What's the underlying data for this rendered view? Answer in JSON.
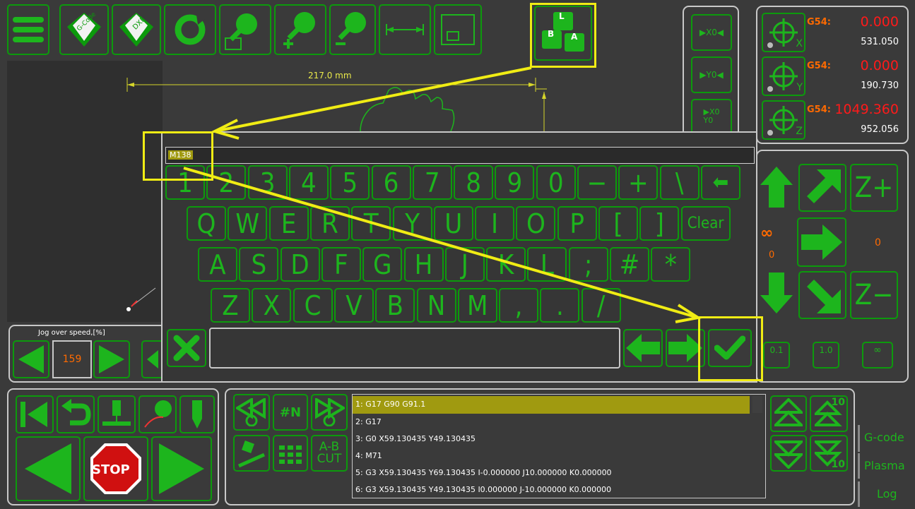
{
  "toolbar": {
    "icons": [
      "menu-icon",
      "gcode-file-icon",
      "dxf-file-icon",
      "refresh-icon",
      "zoom-fit-icon",
      "zoom-in-icon",
      "zoom-out-icon",
      "measure-icon",
      "window-icon",
      "keyboard-layout-icon"
    ],
    "gcode_label": "G-Code",
    "dxf_label": "DXF"
  },
  "keyboard_button": {
    "letters": [
      "L",
      "B",
      "A"
    ]
  },
  "drawing": {
    "dimension": "217.0 mm"
  },
  "zero_buttons": {
    "x0": "▶X0◀",
    "y0": "▶Y0◀",
    "xy0": "▶X0\nY0"
  },
  "dro": [
    {
      "cs": "G54:",
      "work": "0.000",
      "machine": "531.050",
      "axis": "X"
    },
    {
      "cs": "G54:",
      "work": "0.000",
      "machine": "190.730",
      "axis": "Y"
    },
    {
      "cs": "G54:",
      "work": "1049.360",
      "machine": "952.056",
      "axis": "Z"
    }
  ],
  "keyboard": {
    "input": "M138",
    "rows": [
      [
        "1",
        "2",
        "3",
        "4",
        "5",
        "6",
        "7",
        "8",
        "9",
        "0",
        "−",
        "+",
        "\\",
        "⬅"
      ],
      [
        "Q",
        "W",
        "E",
        "R",
        "T",
        "Y",
        "U",
        "I",
        "O",
        "P",
        "[",
        "]",
        "Clear"
      ],
      [
        "A",
        "S",
        "D",
        "F",
        "G",
        "H",
        "J",
        "K",
        "L",
        ";",
        "#",
        "*"
      ],
      [
        "Z",
        "X",
        "C",
        "V",
        "B",
        "N",
        "M",
        ",",
        ".",
        "/"
      ]
    ]
  },
  "jog": {
    "infinity": "∞",
    "left_value": "0",
    "right_value": "0",
    "zplus": "Z+",
    "zminus": "Z−",
    "steps": [
      "0.1",
      "1.0",
      "∞"
    ]
  },
  "jog_speed": {
    "title": "Jog over speed,[%]",
    "value": "159"
  },
  "controls": {
    "stop": "STOP",
    "ab_cut": "A-B\nCUT",
    "hash_n": "#N"
  },
  "gcode": {
    "lines": [
      "1: G17 G90 G91.1",
      "2: G17",
      "3: G0 X59.130435 Y49.130435",
      "4: M71",
      "5: G3 X59.130435 Y69.130435 I-0.000000 J10.000000 K0.000000",
      "6: G3 X59.130435 Y49.130435 I0.000000 J-10.000000 K0.000000"
    ]
  },
  "scroll": {
    "ten_up": "10",
    "ten_down": "10"
  },
  "tabs": [
    "G-code",
    "Plasma",
    "Log"
  ],
  "colors": {
    "accent": "#1db51d",
    "highlight": "#f0ec14",
    "warning": "#ff6a00",
    "red": "#ff1a1a"
  }
}
